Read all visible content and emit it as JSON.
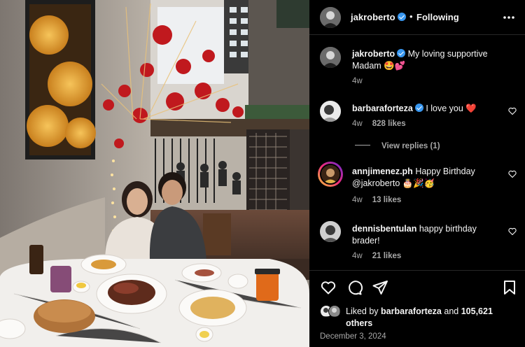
{
  "header": {
    "username": "jakroberto",
    "separator": "•",
    "follow_status": "Following"
  },
  "caption": {
    "username": "jakroberto",
    "text": "My loving supportive Madam 🤩💕",
    "time": "4w"
  },
  "comments": [
    {
      "username": "barbaraforteza",
      "text": "I love you ❤️",
      "time": "4w",
      "likes": "828 likes",
      "view_replies": "View replies (1)"
    },
    {
      "username": "annjimenez.ph",
      "text": "Happy Birthday @jakroberto 🎂🎉🥳",
      "time": "4w",
      "likes": "13 likes"
    },
    {
      "username": "dennisbentulan",
      "text": "happy birthday brader!",
      "time": "4w",
      "likes": "21 likes"
    }
  ],
  "liked_by": {
    "prefix": "Liked by",
    "username": "barbaraforteza",
    "connector": "and",
    "count": "105,621",
    "suffix": "others"
  },
  "post_date": "December 3, 2024",
  "icons": {
    "more": "more-horizontal-icon",
    "like": "heart-icon",
    "comment": "comment-icon",
    "share": "send-icon",
    "save": "bookmark-icon"
  },
  "colors": {
    "background": "#000000",
    "text": "#f5f5f5",
    "muted": "#a8a8a8",
    "verified": "#3897f0",
    "divider": "#262626"
  }
}
